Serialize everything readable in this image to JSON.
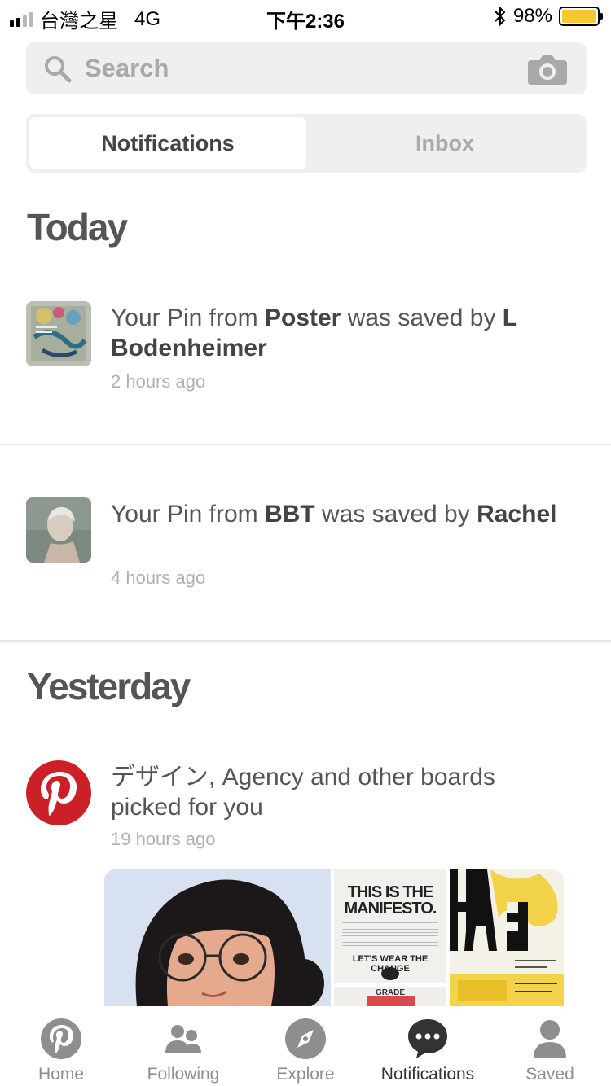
{
  "status_bar": {
    "carrier": "台灣之星",
    "network": "4G",
    "time": "下午2:36",
    "battery": "98%",
    "battery_level": 0.98
  },
  "search": {
    "placeholder": "Search"
  },
  "tabs": [
    {
      "label": "Notifications",
      "active": true
    },
    {
      "label": "Inbox",
      "active": false
    }
  ],
  "sections": {
    "today": "Today",
    "yesterday": "Yesterday"
  },
  "notifications": [
    {
      "pre": "Your Pin from ",
      "board": "Poster",
      "mid": " was saved by ",
      "user": "L Bodenheimer",
      "time": "2 hours ago"
    },
    {
      "pre": "Your Pin from ",
      "board": "BBT",
      "mid": " was saved by ",
      "user": "Rachel",
      "time": "4 hours ago"
    },
    {
      "text": "デザイン, Agency and other boards picked for you",
      "time": "19 hours ago"
    }
  ],
  "picked_pins": {
    "manifesto_line1": "THIS IS THE",
    "manifesto_line2": "MANIFESTO.",
    "manifesto_sub": "LET'S WEAR THE CHANGE",
    "manifesto_badge": "GRADE"
  },
  "tab_bar": [
    {
      "label": "Home",
      "icon": "pinterest-icon",
      "active": false
    },
    {
      "label": "Following",
      "icon": "people-icon",
      "active": false
    },
    {
      "label": "Explore",
      "icon": "compass-icon",
      "active": false
    },
    {
      "label": "Notifications",
      "icon": "speech-bubble-icon",
      "active": true
    },
    {
      "label": "Saved",
      "icon": "person-icon",
      "active": false
    }
  ],
  "colors": {
    "pinterest_red": "#cb2027",
    "battery": "#f5c731"
  }
}
